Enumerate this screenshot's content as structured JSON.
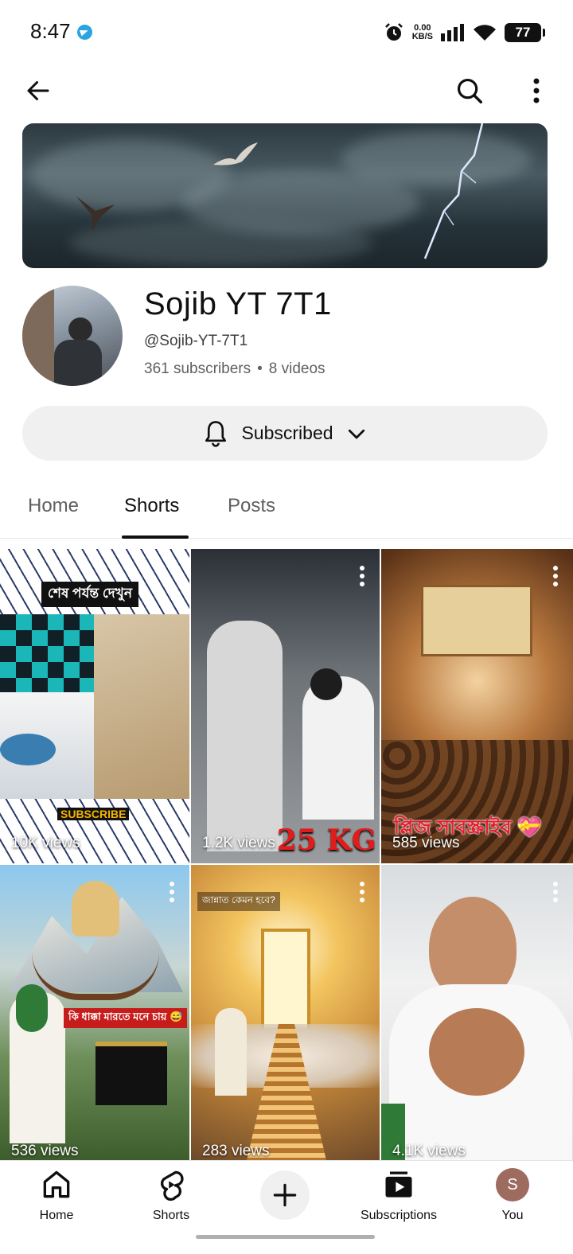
{
  "status_bar": {
    "time": "8:47",
    "network_speed": "0.00",
    "network_unit": "KB/S",
    "battery": "77"
  },
  "channel": {
    "name": "Sojib YT 7T1",
    "handle": "@Sojib-YT-7T1",
    "subscribers": "361 subscribers",
    "separator": "•",
    "videos": "8 videos"
  },
  "subscribe": {
    "label": "Subscribed"
  },
  "tabs": [
    {
      "label": "Home"
    },
    {
      "label": "Shorts"
    },
    {
      "label": "Posts"
    }
  ],
  "shorts": [
    {
      "views": "10K views",
      "overlay_top": "শেষ পর্যন্ত দেখুন",
      "overlay_bottom": "SUBSCRIBE"
    },
    {
      "views": "1.2K views",
      "overlay_bottom": "25 KG"
    },
    {
      "views": "585 views",
      "overlay_bottom": "প্লিজ সাবস্ক্রাইব 💝"
    },
    {
      "views": "536 views",
      "overlay_mid": "কি ধাক্কা মারতে মনে চায় 😅"
    },
    {
      "views": "283 views",
      "overlay_top": "জান্নাত কেমন হবে?"
    },
    {
      "views": "4.1K views"
    }
  ],
  "bottom_nav": [
    {
      "label": "Home"
    },
    {
      "label": "Shorts"
    },
    {
      "label": "Subscriptions"
    },
    {
      "label": "You",
      "avatar_letter": "S"
    }
  ],
  "colors": {
    "accent": "#0f0f0f",
    "button_bg": "#f0f0f0",
    "avatar_bg": "#9e6b5f"
  },
  "icons": [
    "back-arrow-icon",
    "search-icon",
    "more-vert-icon",
    "bell-icon",
    "chevron-down-icon",
    "home-icon",
    "shorts-icon",
    "plus-icon",
    "subscriptions-icon"
  ]
}
